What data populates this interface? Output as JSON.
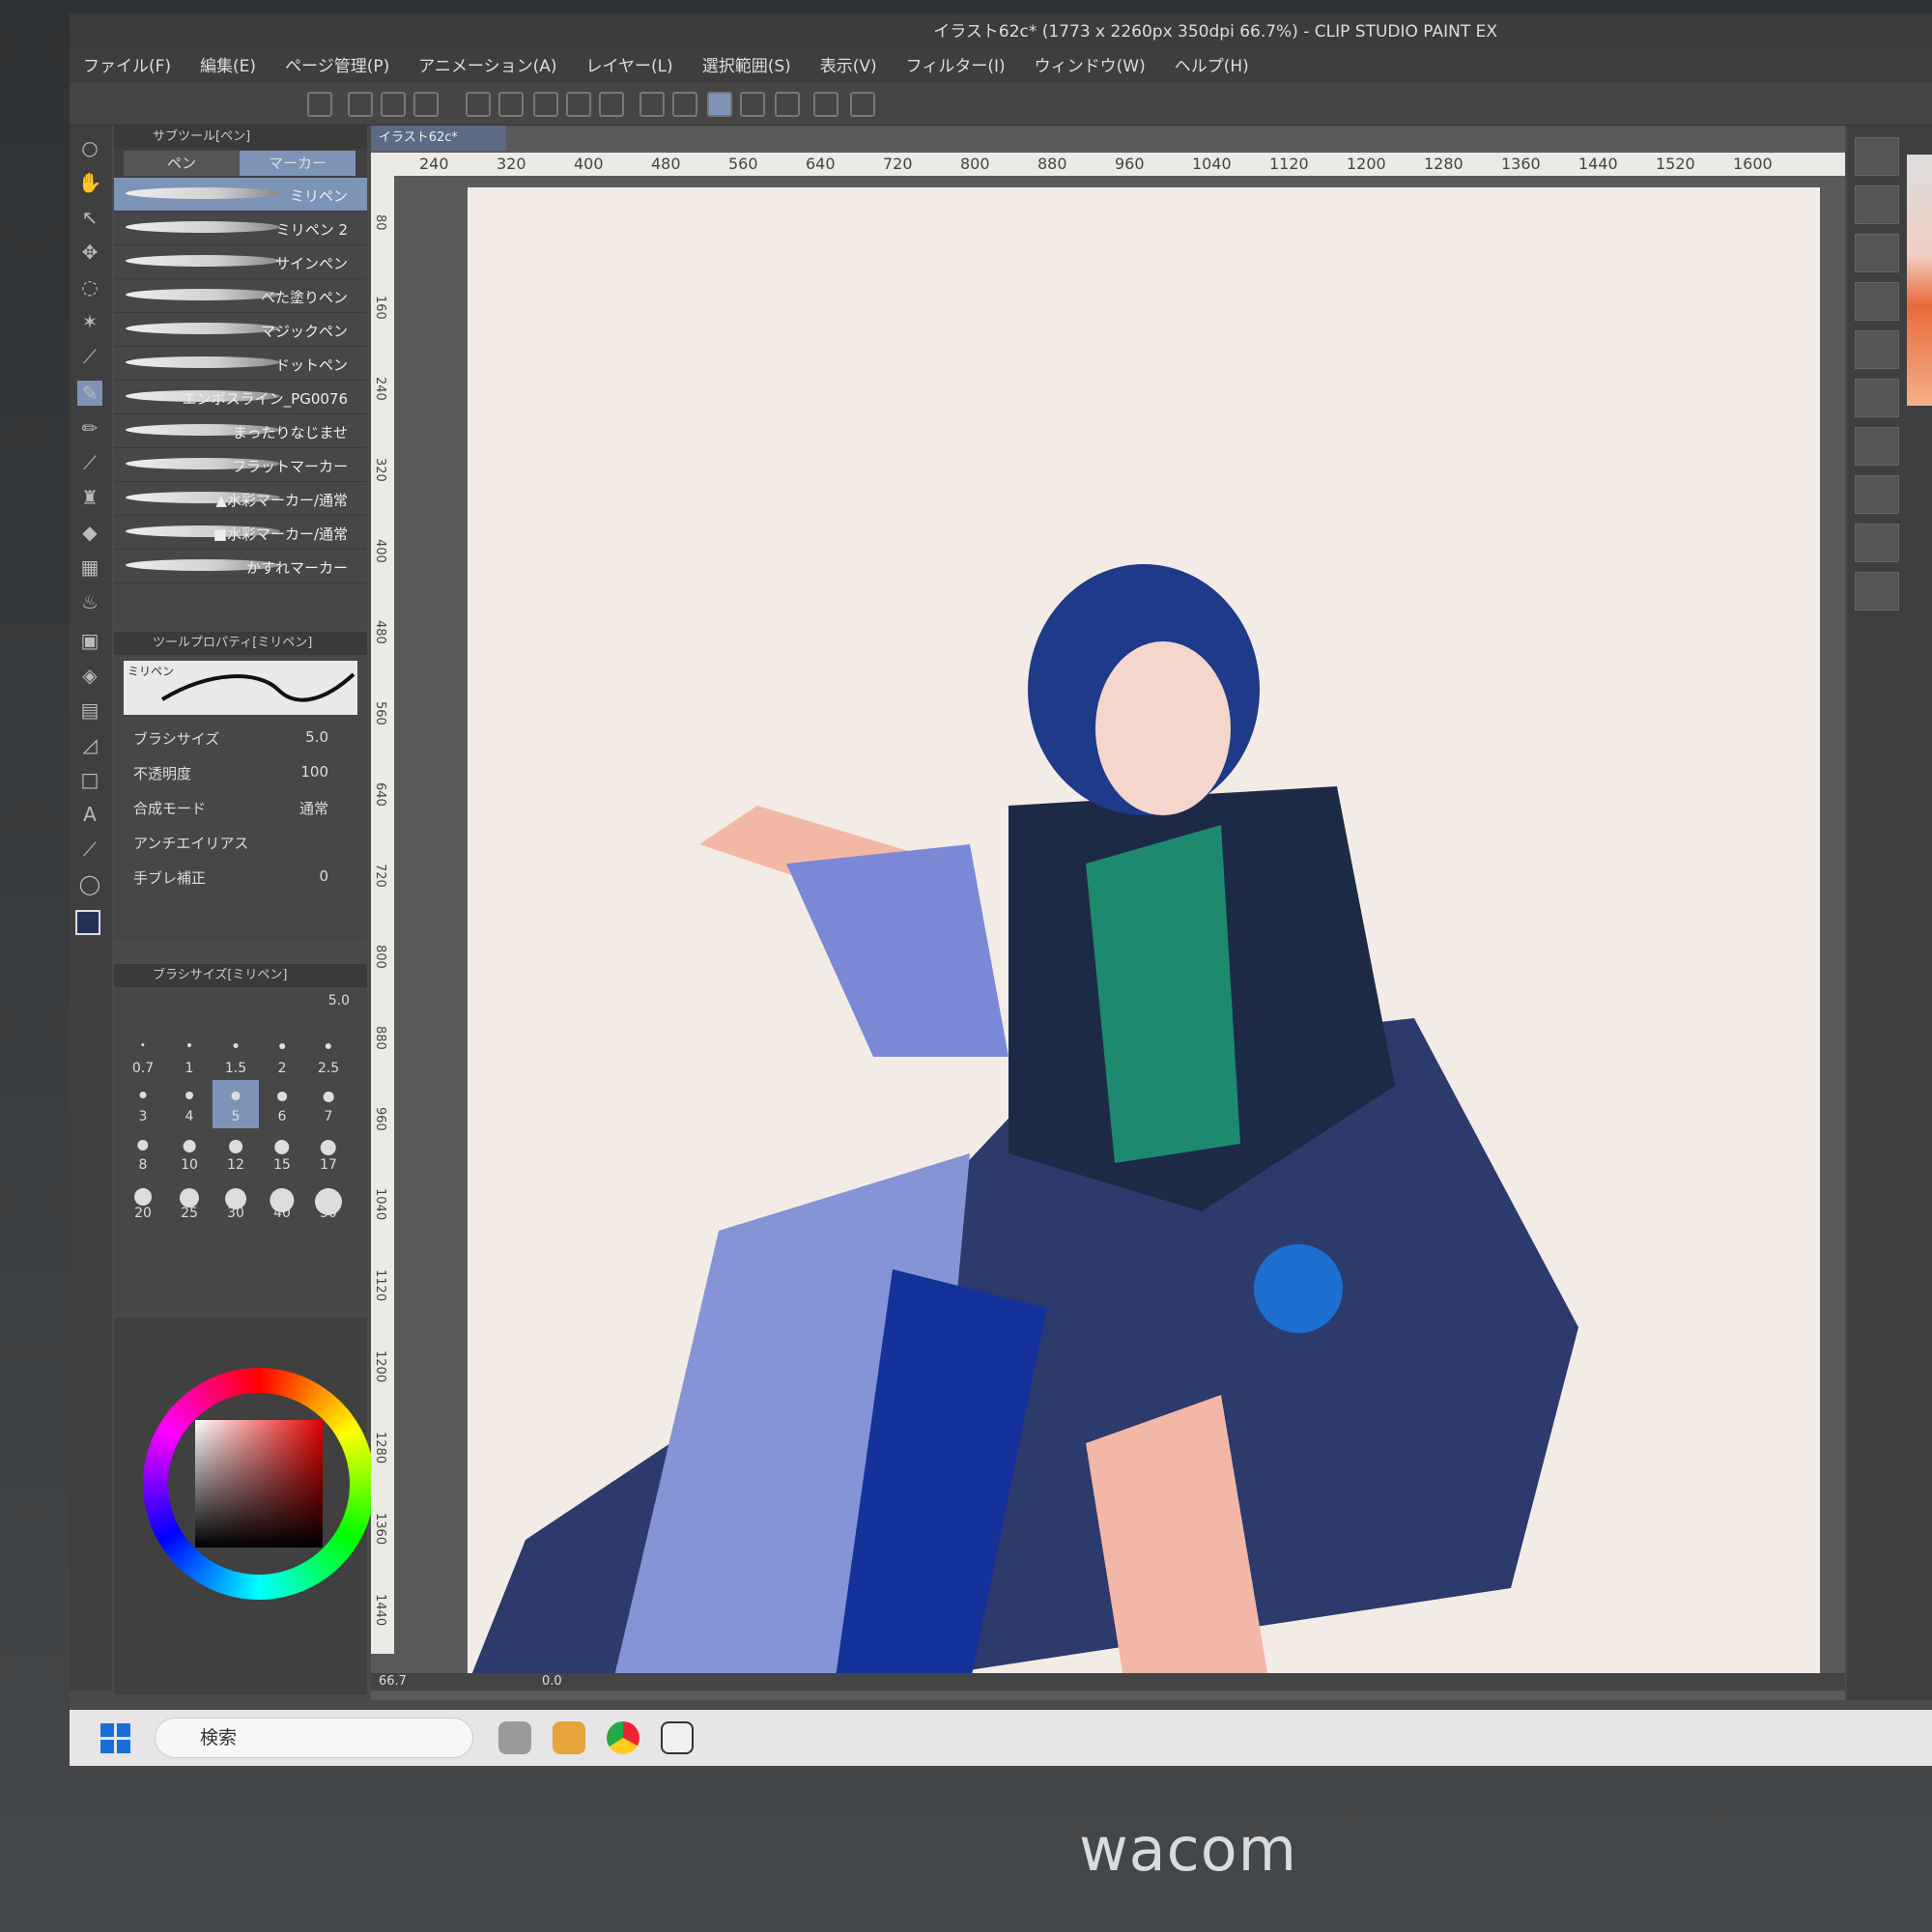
{
  "window": {
    "title": "イラスト62c* (1773 x 2260px 350dpi 66.7%) - CLIP STUDIO PAINT EX"
  },
  "menu": [
    "ファイル(F)",
    "編集(E)",
    "ページ管理(P)",
    "アニメーション(A)",
    "レイヤー(L)",
    "選択範囲(S)",
    "表示(V)",
    "フィルター(I)",
    "ウィンドウ(W)",
    "ヘルプ(H)"
  ],
  "subtool": {
    "header": "サブツール[ペン]",
    "tabs": [
      "ペン",
      "マーカー"
    ],
    "brushes": [
      "ミリペン",
      "ミリペン 2",
      "サインペン",
      "べた塗りペン",
      "マジックペン",
      "ドットペン",
      "エンボスライン_PG0076",
      "まったりなじませ",
      "フラットマーカー",
      "▲水彩マーカー/通常",
      "■水彩マーカー/通常",
      "かすれマーカー"
    ]
  },
  "tool_property": {
    "header": "ツールプロパティ[ミリペン]",
    "preset": "ミリペン",
    "rows": [
      {
        "label": "ブラシサイズ",
        "value": "5.0"
      },
      {
        "label": "不透明度",
        "value": "100"
      },
      {
        "label": "合成モード",
        "value": "通常"
      },
      {
        "label": "アンチエイリアス",
        "value": ""
      },
      {
        "label": "手ブレ補正",
        "value": "0"
      }
    ]
  },
  "brush_size": {
    "header": "ブラシサイズ[ミリペン]",
    "current": "5.0",
    "values": [
      "0.7",
      "1",
      "1.5",
      "2",
      "2.5",
      "3",
      "4",
      "5",
      "6",
      "7",
      "8",
      "10",
      "12",
      "15",
      "17",
      "20",
      "25",
      "30",
      "40",
      "50"
    ],
    "selected": "5"
  },
  "document": {
    "tab": "イラスト62c*"
  },
  "ruler": {
    "ticks": [
      "240",
      "320",
      "400",
      "480",
      "560",
      "640",
      "720",
      "800",
      "880",
      "960",
      "1040",
      "1120",
      "1200",
      "1280",
      "1360",
      "1440",
      "1520",
      "1600"
    ]
  },
  "vruler": {
    "ticks": [
      "80",
      "160",
      "240",
      "320",
      "400",
      "480",
      "560",
      "640",
      "720",
      "800",
      "880",
      "960",
      "1040",
      "1120",
      "1200",
      "1280",
      "1360",
      "1440"
    ]
  },
  "status": {
    "zoom": "66.7",
    "rotation": "0.0"
  },
  "taskbar": {
    "search_placeholder": "検索"
  },
  "device": {
    "brand": "wacom"
  },
  "colors": {
    "accent": "#7e93b8",
    "canvas": "#f3ece6",
    "main_color": "#24325a",
    "sub_color": "#ffffff"
  }
}
